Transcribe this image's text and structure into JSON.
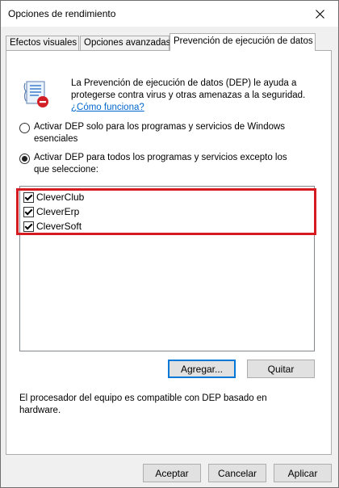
{
  "window": {
    "title": "Opciones de rendimiento"
  },
  "tabs": [
    {
      "label": "Efectos visuales"
    },
    {
      "label": "Opciones avanzadas"
    },
    {
      "label": "Prevención de ejecución de datos"
    }
  ],
  "info": {
    "text": "La Prevención de ejecución de datos (DEP) le ayuda a protegerse contra virus y otras amenazas a la seguridad.",
    "link": "¿Cómo funciona?"
  },
  "options": {
    "essential": "Activar DEP solo para los programas y servicios de Windows esenciales",
    "all_except": "Activar DEP para todos los programas y servicios excepto los que seleccione:"
  },
  "programs": [
    {
      "label": "CleverClub",
      "checked": true
    },
    {
      "label": "CleverErp",
      "checked": true
    },
    {
      "label": "CleverSoft",
      "checked": true
    }
  ],
  "buttons": {
    "add": "Agregar...",
    "remove": "Quitar",
    "accept": "Aceptar",
    "cancel": "Cancelar",
    "apply": "Aplicar"
  },
  "hardware_note": "El procesador del equipo es compatible con DEP basado en hardware.",
  "colors": {
    "highlight": "#d71920",
    "link": "#0066cc"
  }
}
